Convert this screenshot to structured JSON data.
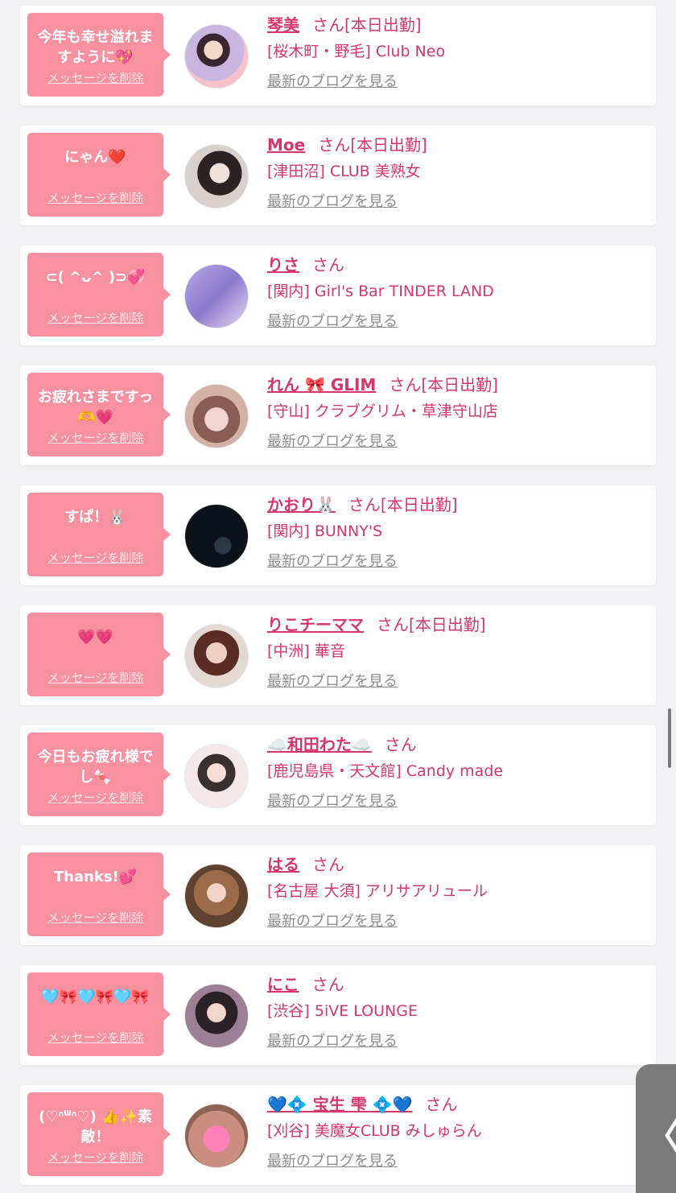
{
  "entries": [
    {
      "message": "今年も幸せ溢れますように💖",
      "delete_label": "メッセージを削除",
      "name": "琴美",
      "san": "さん",
      "tag": "[本日出勤]",
      "shop": "[桜木町・野毛] Club Neo",
      "blog_label": "最新のブログを見る"
    },
    {
      "message": "にゃん❤️",
      "delete_label": "メッセージを削除",
      "name": "Moe",
      "san": "さん",
      "tag": "[本日出勤]",
      "shop": "[津田沼] CLUB 美熟女",
      "blog_label": "最新のブログを見る"
    },
    {
      "message": "⊂( ^ᴗ^ )⊃💞",
      "delete_label": "メッセージを削除",
      "name": "りさ",
      "san": "さん",
      "tag": "",
      "shop": "[関内] Girl's Bar TINDER LAND",
      "blog_label": "最新のブログを見る"
    },
    {
      "message": "お疲れさまですっ🫶💗",
      "delete_label": "メッセージを削除",
      "name": "れん 🎀 GLIM",
      "san": "さん",
      "tag": "[本日出勤]",
      "shop": "[守山] クラブグリム・草津守山店",
      "blog_label": "最新のブログを見る"
    },
    {
      "message": "すぱ！🐰",
      "delete_label": "メッセージを削除",
      "name": "かおり🐰",
      "san": "さん",
      "tag": "[本日出勤]",
      "shop": "[関内] BUNNY'S",
      "blog_label": "最新のブログを見る"
    },
    {
      "message": "💗💗",
      "delete_label": "メッセージを削除",
      "name": "りこチーママ",
      "san": "さん",
      "tag": "[本日出勤]",
      "shop": "[中洲] 華音",
      "blog_label": "最新のブログを見る"
    },
    {
      "message": "今日もお疲れ様でし🍬",
      "delete_label": "メッセージを削除",
      "name": "☁️和田わた☁️",
      "san": "さん",
      "tag": "",
      "shop": "[鹿児島県・天文館] Candy made",
      "blog_label": "最新のブログを見る"
    },
    {
      "message": "Thanks!💕",
      "delete_label": "メッセージを削除",
      "name": "はる",
      "san": "さん",
      "tag": "",
      "shop": "[名古屋 大須] アリサアリュール",
      "blog_label": "最新のブログを見る"
    },
    {
      "message": "🩵🎀🩵🎀🩵🎀",
      "delete_label": "メッセージを削除",
      "name": "にこ",
      "san": "さん",
      "tag": "",
      "shop": "[渋谷] 5iVE LOUNGE",
      "blog_label": "最新のブログを見る"
    },
    {
      "message": "(♡ᐢᐜᐢ♡) 👍✨素敵！",
      "delete_label": "メッセージを削除",
      "name": "💙💠 宝生 雫 💠💙",
      "san": "さん",
      "tag": "",
      "shop": "[刈谷] 美魔女CLUB みしゅらん",
      "blog_label": "最新のブログを見る"
    }
  ],
  "side_tab_label": "〈",
  "colors": {
    "accent": "#d6376a",
    "bubble": "#f7909f",
    "link_gray": "#8d8d8d"
  },
  "avatar_styles": [
    "radial-gradient(circle at 45% 40%, #f3d7c9 0 18%, #3a2630 19% 32%, #c8b6e0 33% 60%, #f6c1c9 61%)",
    "radial-gradient(circle at 55% 45%, #efe2dc 0 20%, #2b2323 21% 45%, #d9cfcb 46%)",
    "linear-gradient(135deg, #b9a6e8, #8a7acb 50%, #e9d7f4)",
    "radial-gradient(circle at 50% 55%, #f1d6cf 0 25%, #8a5c56 26% 50%, #d3b1a7 51%)",
    "radial-gradient(circle at 60% 65%, #2a3946 0 15%, #0c1219 16%)",
    "radial-gradient(circle at 50% 45%, #f0cfc3 0 22%, #5a2c23 23% 48%, #e3d8d2 49%)",
    "radial-gradient(circle at 50% 45%, #f6ded7 0 20%, #39312f 21% 40%, #f5e8ea 41%)",
    "radial-gradient(circle at 50% 45%, #f0d4c6 0 20%, #9b6a49 21% 48%, #5f4330 49%)",
    "radial-gradient(circle at 50% 45%, #f2d5cb 0 20%, #2b2228 21% 45%, #9c7f94 46%)",
    "radial-gradient(circle at 50% 55%, #ff7fb7 0 28%, #c98e80 29% 60%, #8f6455 61%)"
  ]
}
